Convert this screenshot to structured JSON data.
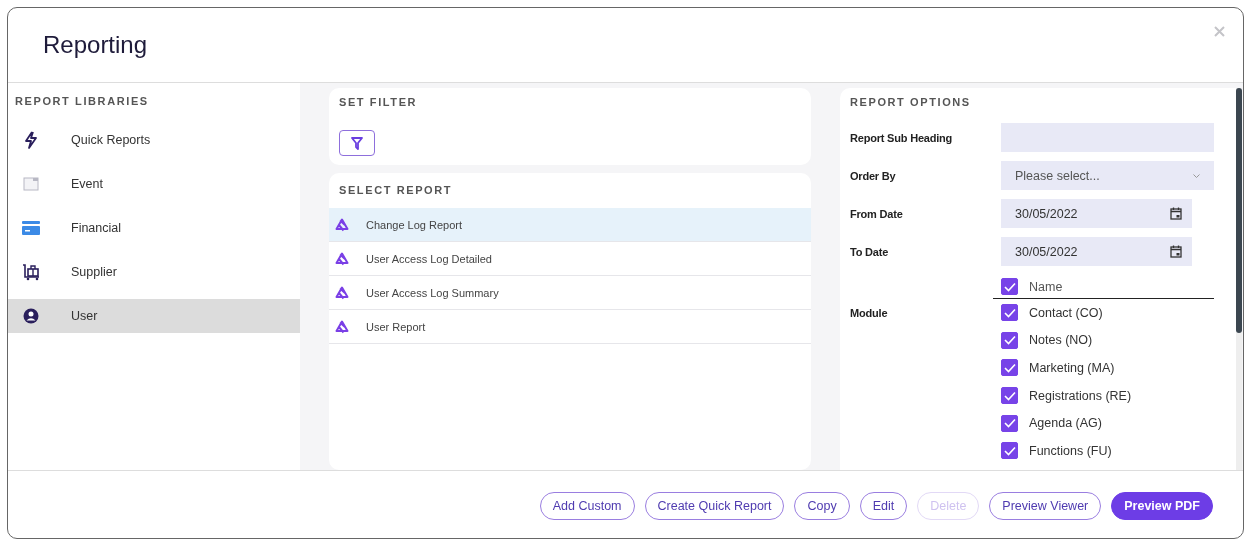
{
  "window": {
    "title": "Reporting"
  },
  "report_libraries": {
    "heading": "REPORT LIBRARIES",
    "items": [
      {
        "label": "Quick Reports",
        "selected": false
      },
      {
        "label": "Event",
        "selected": false
      },
      {
        "label": "Financial",
        "selected": false
      },
      {
        "label": "Supplier",
        "selected": false
      },
      {
        "label": "User",
        "selected": true
      }
    ]
  },
  "set_filter": {
    "heading": "SET FILTER"
  },
  "select_report": {
    "heading": "SELECT REPORT",
    "items": [
      {
        "label": "Change Log Report",
        "selected": true
      },
      {
        "label": "User Access Log Detailed",
        "selected": false
      },
      {
        "label": "User Access Log Summary",
        "selected": false
      },
      {
        "label": "User Report",
        "selected": false
      }
    ]
  },
  "report_options": {
    "heading": "REPORT OPTIONS",
    "fields": [
      {
        "kind": "text",
        "label": "Report Sub Heading"
      },
      {
        "kind": "select",
        "label": "Order By",
        "placeholder": "Please select..."
      },
      {
        "kind": "date",
        "label": "From Date",
        "value": "30/05/2022"
      },
      {
        "kind": "date",
        "label": "To Date",
        "value": "30/05/2022"
      },
      {
        "kind": "checklist",
        "label": "Module",
        "header": {
          "label": "Name",
          "checked": true
        },
        "options": [
          {
            "label": "Contact (CO)",
            "checked": true
          },
          {
            "label": "Notes (NO)",
            "checked": true
          },
          {
            "label": "Marketing (MA)",
            "checked": true
          },
          {
            "label": "Registrations (RE)",
            "checked": true
          },
          {
            "label": "Agenda (AG)",
            "checked": true
          },
          {
            "label": "Functions (FU)",
            "checked": true
          }
        ]
      }
    ]
  },
  "buttons": [
    {
      "label": "Add Custom",
      "kind": "outline",
      "disabled": false
    },
    {
      "label": "Create Quick Report",
      "kind": "outline",
      "disabled": false
    },
    {
      "label": "Copy",
      "kind": "outline",
      "disabled": false
    },
    {
      "label": "Edit",
      "kind": "outline",
      "disabled": false
    },
    {
      "label": "Delete",
      "kind": "outline",
      "disabled": true
    },
    {
      "label": "Preview Viewer",
      "kind": "outline",
      "disabled": false
    },
    {
      "label": "Preview PDF",
      "kind": "primary",
      "disabled": false
    }
  ]
}
